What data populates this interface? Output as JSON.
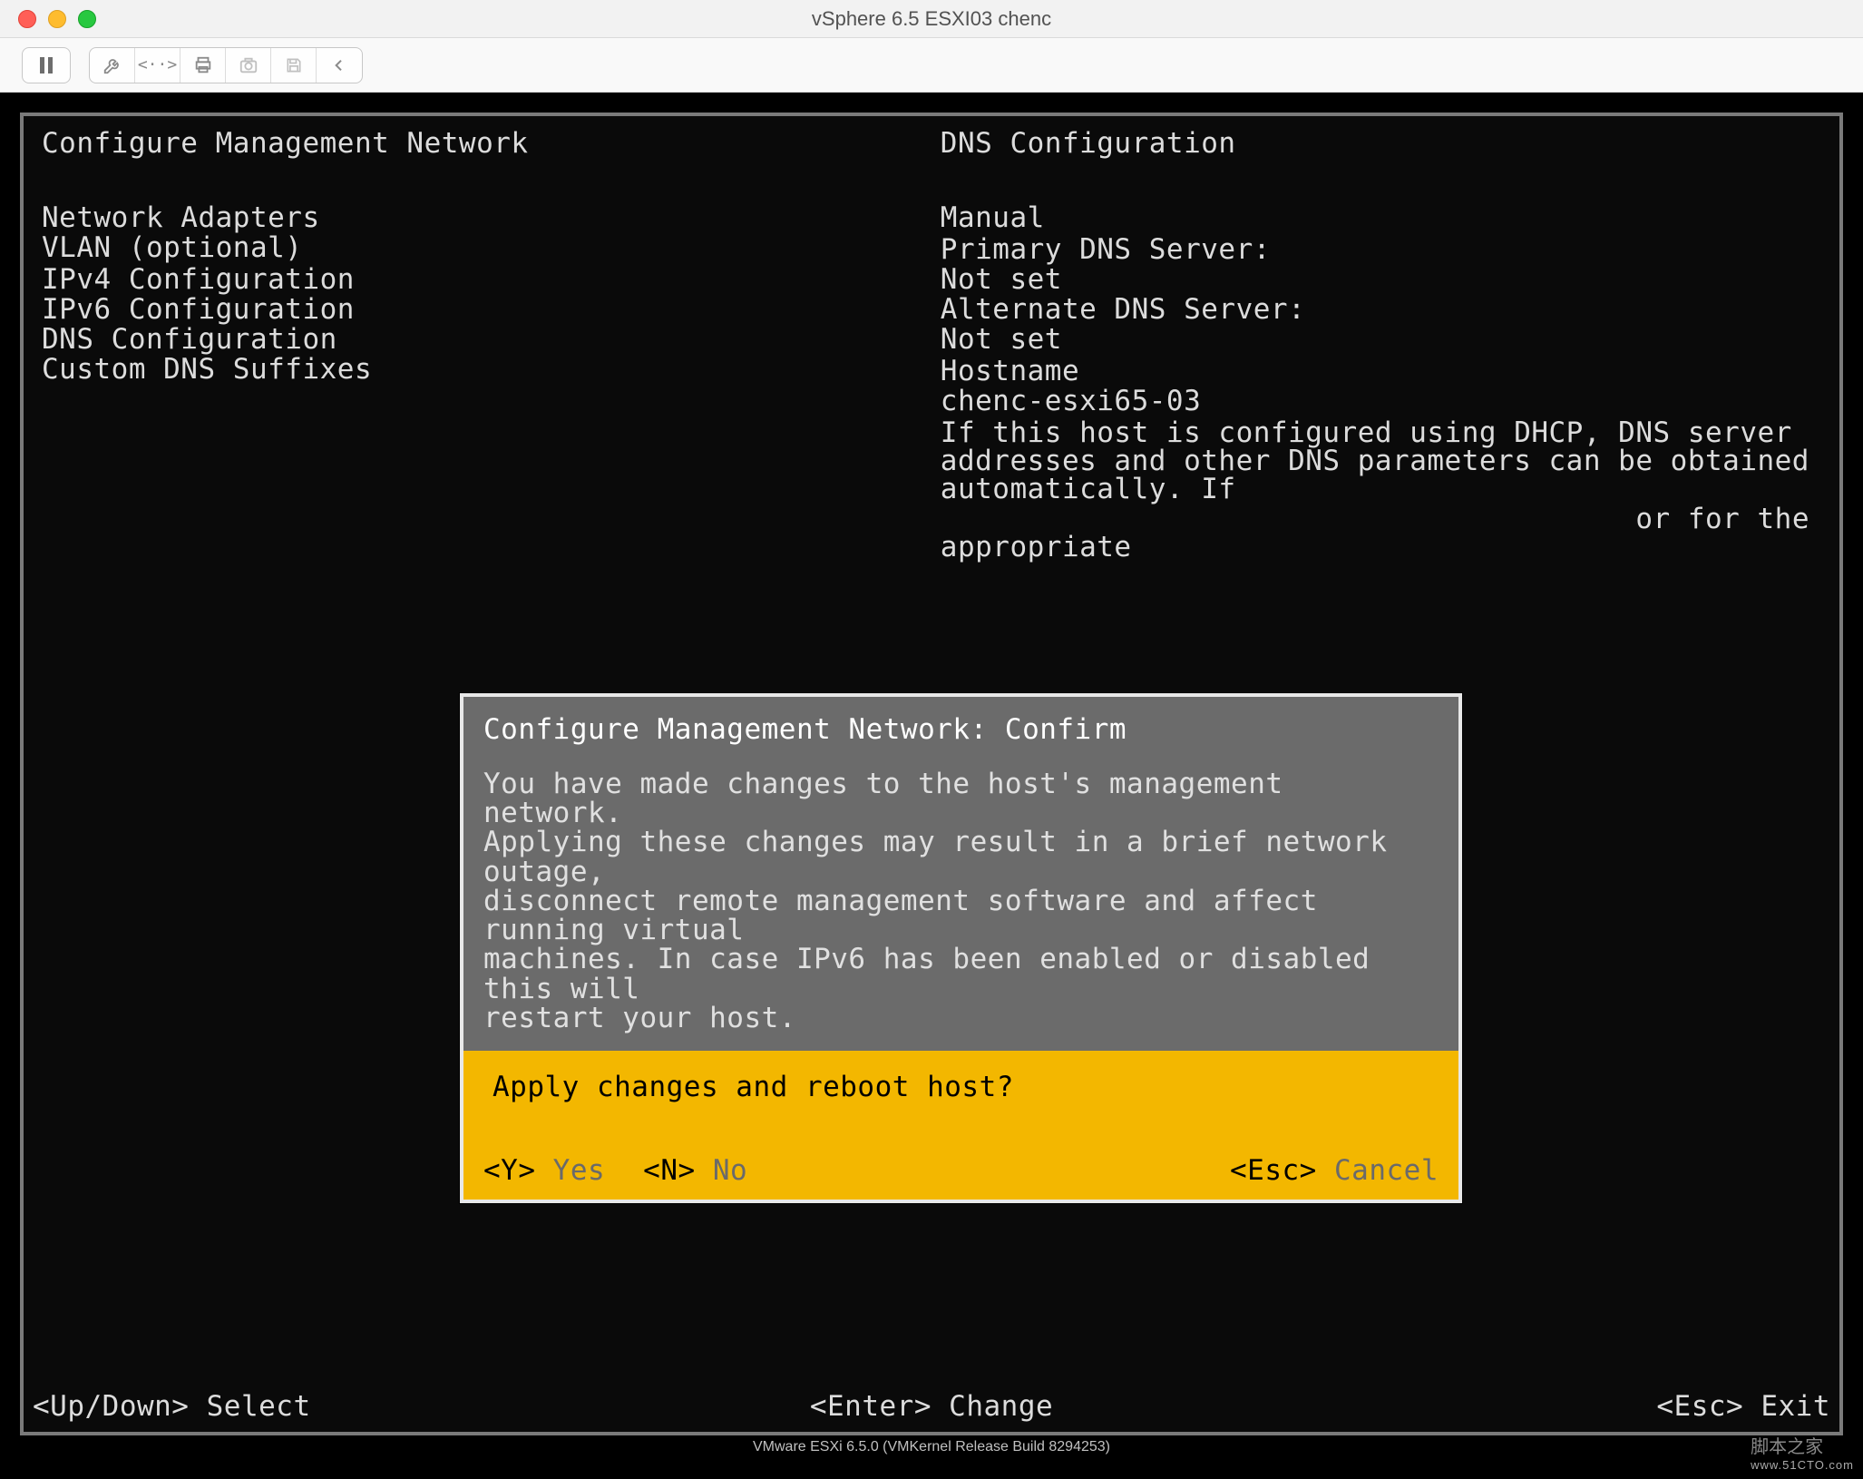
{
  "window": {
    "title": "vSphere 6.5 ESXI03 chenc"
  },
  "toolbar_icons": {
    "pause": "pause-icon",
    "wrench": "wrench-icon",
    "code": "code-icon",
    "printer": "printer-icon",
    "camera": "camera-icon",
    "floppy": "floppy-icon",
    "back": "chevron-left-icon"
  },
  "left_panel": {
    "title": "Configure Management Network",
    "menu": [
      "Network Adapters",
      "VLAN (optional)",
      "",
      "IPv4 Configuration",
      "IPv6 Configuration",
      "DNS Configuration",
      "Custom DNS Suffixes"
    ]
  },
  "right_panel": {
    "title": "DNS Configuration",
    "lines": [
      "Manual",
      "",
      "Primary DNS Server:",
      "Not set",
      "Alternate DNS Server:",
      "Not set",
      "",
      "Hostname",
      "chenc-esxi65-03",
      "",
      "If this host is configured using DHCP, DNS server addresses and other DNS parameters can be obtained automatically. If",
      "                                        or for the appropriate"
    ]
  },
  "dialog": {
    "title": "Configure Management Network: Confirm",
    "body": "You have made changes to the host's management network.\nApplying these changes may result in a brief network outage,\ndisconnect remote management software and affect running virtual\nmachines. In case IPv6 has been enabled or disabled this will\nrestart your host.",
    "prompt": "Apply changes and reboot host?",
    "buttons": {
      "yes_key": "<Y>",
      "yes_label": "Yes",
      "no_key": "<N>",
      "no_label": "No",
      "cancel_key": "<Esc>",
      "cancel_label": "Cancel"
    }
  },
  "footer": {
    "left": "<Up/Down> Select",
    "center": "<Enter> Change",
    "right": "<Esc> Exit"
  },
  "bottom_line": "VMware ESXi 6.5.0 (VMKernel Release Build 8294253)",
  "watermark": {
    "main": "脚本之家",
    "sub": "www.51CTO.com"
  }
}
